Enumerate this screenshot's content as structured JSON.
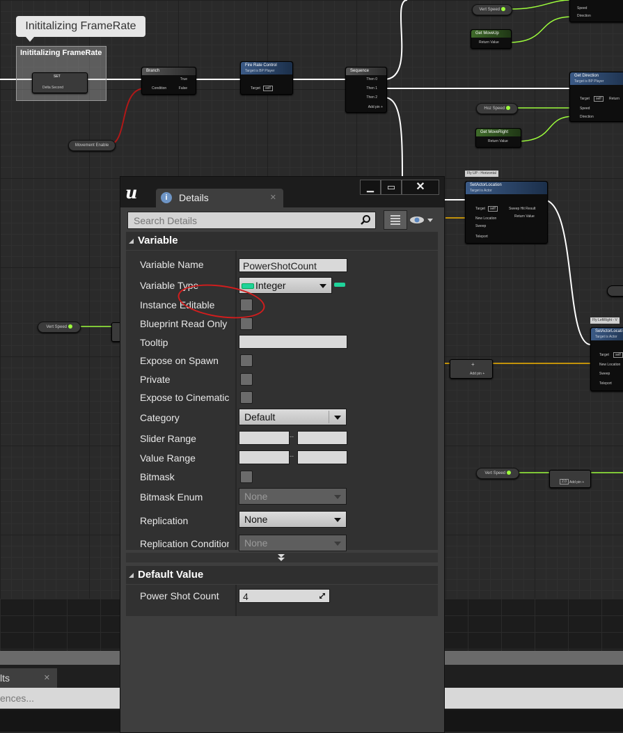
{
  "graph": {
    "tooltip": "Inititalizing FrameRate",
    "comment_title": "Inititalizing FrameRate",
    "nodes": {
      "set": {
        "title": "SET",
        "pin": "Delta Second"
      },
      "branch": {
        "title": "Branch",
        "true": "True",
        "false": "False",
        "condition": "Condition"
      },
      "fire_rate": {
        "title": "Fire Rate Control",
        "subtitle": "Target is BP Player",
        "target": "Target",
        "self": "self"
      },
      "sequence": {
        "title": "Sequence",
        "then0": "Then 0",
        "then1": "Then 1",
        "then2": "Then 2",
        "add": "Add pin +"
      },
      "get_direction": {
        "title": "Get Direction",
        "subtitle": "Target is BP Player",
        "target": "Target",
        "self": "self",
        "speed": "Speed",
        "direction": "Direction",
        "ret": "Return"
      },
      "top_right": {
        "speed": "Speed",
        "direction": "Direction"
      },
      "get_moveup": {
        "title": "Get MoveUp",
        "ret": "Return Value"
      },
      "get_moveright": {
        "title": "Get MoveRight",
        "ret": "Return Value"
      },
      "set_actor_location": {
        "title": "SetActorLocation",
        "subtitle": "Target is Actor",
        "target": "Target",
        "self": "self",
        "new_location": "New Location",
        "sweep": "Sweep",
        "teleport": "Teleport",
        "sweep_hit": "Sweep Hit Result",
        "ret": "Return Value"
      },
      "set_actor_location2": {
        "title": "SetActorLocati",
        "subtitle": "Target is Actor",
        "target": "Target",
        "self": "self",
        "new_location": "New Location",
        "sweep": "Sweep",
        "teleport": "Teleport"
      },
      "add1": {
        "label": "Add pin +"
      },
      "add2": {
        "label": "Add pin +",
        "value": "2.0"
      }
    },
    "pills": {
      "movement_enable": "Movement Enable",
      "vert_speed_top": "Vert Speed",
      "hoz_speed": "Hoz Speed",
      "vert_speed_left": "Vert Speed",
      "vert_speed_bottom": "Vert Speed"
    },
    "tags": {
      "flyup": "Fly UP - Horizontal",
      "flyleft": "Fly LeftRight - V"
    }
  },
  "bottom": {
    "tab": "lts",
    "search": "ences..."
  },
  "details": {
    "tab_title": "Details",
    "search_placeholder": "Search Details",
    "section_variable": "Variable",
    "section_default": "Default Value",
    "rows": {
      "variable_name": {
        "label": "Variable Name",
        "value": "PowerShotCount"
      },
      "variable_type": {
        "label": "Variable Type",
        "value": "Integer"
      },
      "instance_editable": {
        "label": "Instance Editable"
      },
      "blueprint_read_only": {
        "label": "Blueprint Read Only"
      },
      "tooltip": {
        "label": "Tooltip",
        "value": ""
      },
      "expose_on_spawn": {
        "label": "Expose on Spawn"
      },
      "private": {
        "label": "Private"
      },
      "expose_cinematics": {
        "label": "Expose to Cinematics"
      },
      "category": {
        "label": "Category",
        "value": "Default"
      },
      "slider_range": {
        "label": "Slider Range",
        "separator": "--"
      },
      "value_range": {
        "label": "Value Range",
        "separator": "--"
      },
      "bitmask": {
        "label": "Bitmask"
      },
      "bitmask_enum": {
        "label": "Bitmask Enum",
        "value": "None"
      },
      "replication": {
        "label": "Replication",
        "value": "None"
      },
      "replication_condition": {
        "label": "Replication Condition",
        "value": "None"
      }
    },
    "default_value": {
      "label": "Power Shot Count",
      "value": "4"
    }
  },
  "colors": {
    "exec": "#ffffff",
    "float_pin": "#9dfd3c",
    "bool_wire": "#b01818",
    "struct_wire": "#f4b400",
    "annotation": "#d21d1d"
  }
}
